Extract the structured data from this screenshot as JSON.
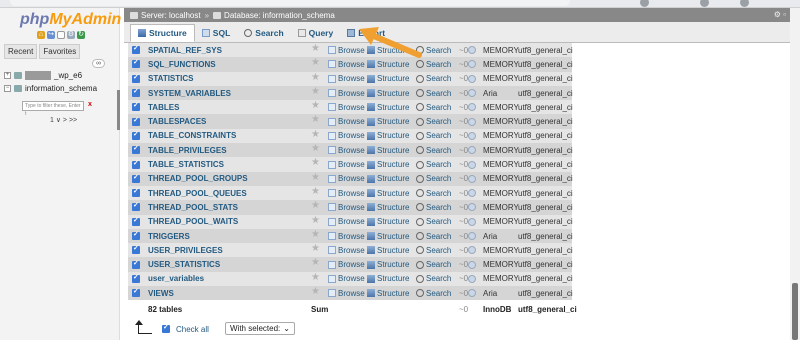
{
  "app": {
    "logo_php": "php",
    "logo_my": "MyAdmin"
  },
  "left": {
    "tabs": [
      "Recent",
      "Favorites"
    ],
    "collapse_label": "∞",
    "db_blurred_suffix": "_wp_e6",
    "db_current": "information_schema",
    "filter_placeholder": "Type to filter these, Enter t",
    "filter_clear": "x",
    "pager": "1  ∨  > >>"
  },
  "breadcrumb": {
    "server": "Server: localhost",
    "database": "Database: information_schema"
  },
  "menu": {
    "tabs": [
      {
        "label": "Structure",
        "active": true
      },
      {
        "label": "SQL",
        "active": false
      },
      {
        "label": "Search",
        "active": false
      },
      {
        "label": "Query",
        "active": false
      },
      {
        "label": "Export",
        "active": false
      }
    ]
  },
  "actions": {
    "browse": "Browse",
    "structure": "Structure",
    "search": "Search"
  },
  "tables": [
    {
      "name": "SPATIAL_REF_SYS",
      "engine": "MEMORY",
      "collation": "utf8_general_ci"
    },
    {
      "name": "SQL_FUNCTIONS",
      "engine": "MEMORY",
      "collation": "utf8_general_ci"
    },
    {
      "name": "STATISTICS",
      "engine": "MEMORY",
      "collation": "utf8_general_ci"
    },
    {
      "name": "SYSTEM_VARIABLES",
      "engine": "Aria",
      "collation": "utf8_general_ci"
    },
    {
      "name": "TABLES",
      "engine": "MEMORY",
      "collation": "utf8_general_ci"
    },
    {
      "name": "TABLESPACES",
      "engine": "MEMORY",
      "collation": "utf8_general_ci"
    },
    {
      "name": "TABLE_CONSTRAINTS",
      "engine": "MEMORY",
      "collation": "utf8_general_ci"
    },
    {
      "name": "TABLE_PRIVILEGES",
      "engine": "MEMORY",
      "collation": "utf8_general_ci"
    },
    {
      "name": "TABLE_STATISTICS",
      "engine": "MEMORY",
      "collation": "utf8_general_ci"
    },
    {
      "name": "THREAD_POOL_GROUPS",
      "engine": "MEMORY",
      "collation": "utf8_general_ci"
    },
    {
      "name": "THREAD_POOL_QUEUES",
      "engine": "MEMORY",
      "collation": "utf8_general_ci"
    },
    {
      "name": "THREAD_POOL_STATS",
      "engine": "MEMORY",
      "collation": "utf8_general_ci"
    },
    {
      "name": "THREAD_POOL_WAITS",
      "engine": "MEMORY",
      "collation": "utf8_general_ci"
    },
    {
      "name": "TRIGGERS",
      "engine": "Aria",
      "collation": "utf8_general_ci"
    },
    {
      "name": "USER_PRIVILEGES",
      "engine": "MEMORY",
      "collation": "utf8_general_ci"
    },
    {
      "name": "USER_STATISTICS",
      "engine": "MEMORY",
      "collation": "utf8_general_ci"
    },
    {
      "name": "user_variables",
      "engine": "MEMORY",
      "collation": "utf8_general_ci"
    },
    {
      "name": "VIEWS",
      "engine": "Aria",
      "collation": "utf8_general_ci"
    }
  ],
  "summary": {
    "count": "82 tables",
    "sum": "Sum",
    "dash": "~0",
    "engine": "InnoDB",
    "collation": "utf8_general_ci"
  },
  "row_dash": "~0",
  "footer": {
    "check_all": "Check all",
    "with_selected": "With selected:"
  },
  "colors": {
    "link": "#235a81",
    "accent_orange": "#f0a030",
    "checkbox": "#3a78d6"
  }
}
